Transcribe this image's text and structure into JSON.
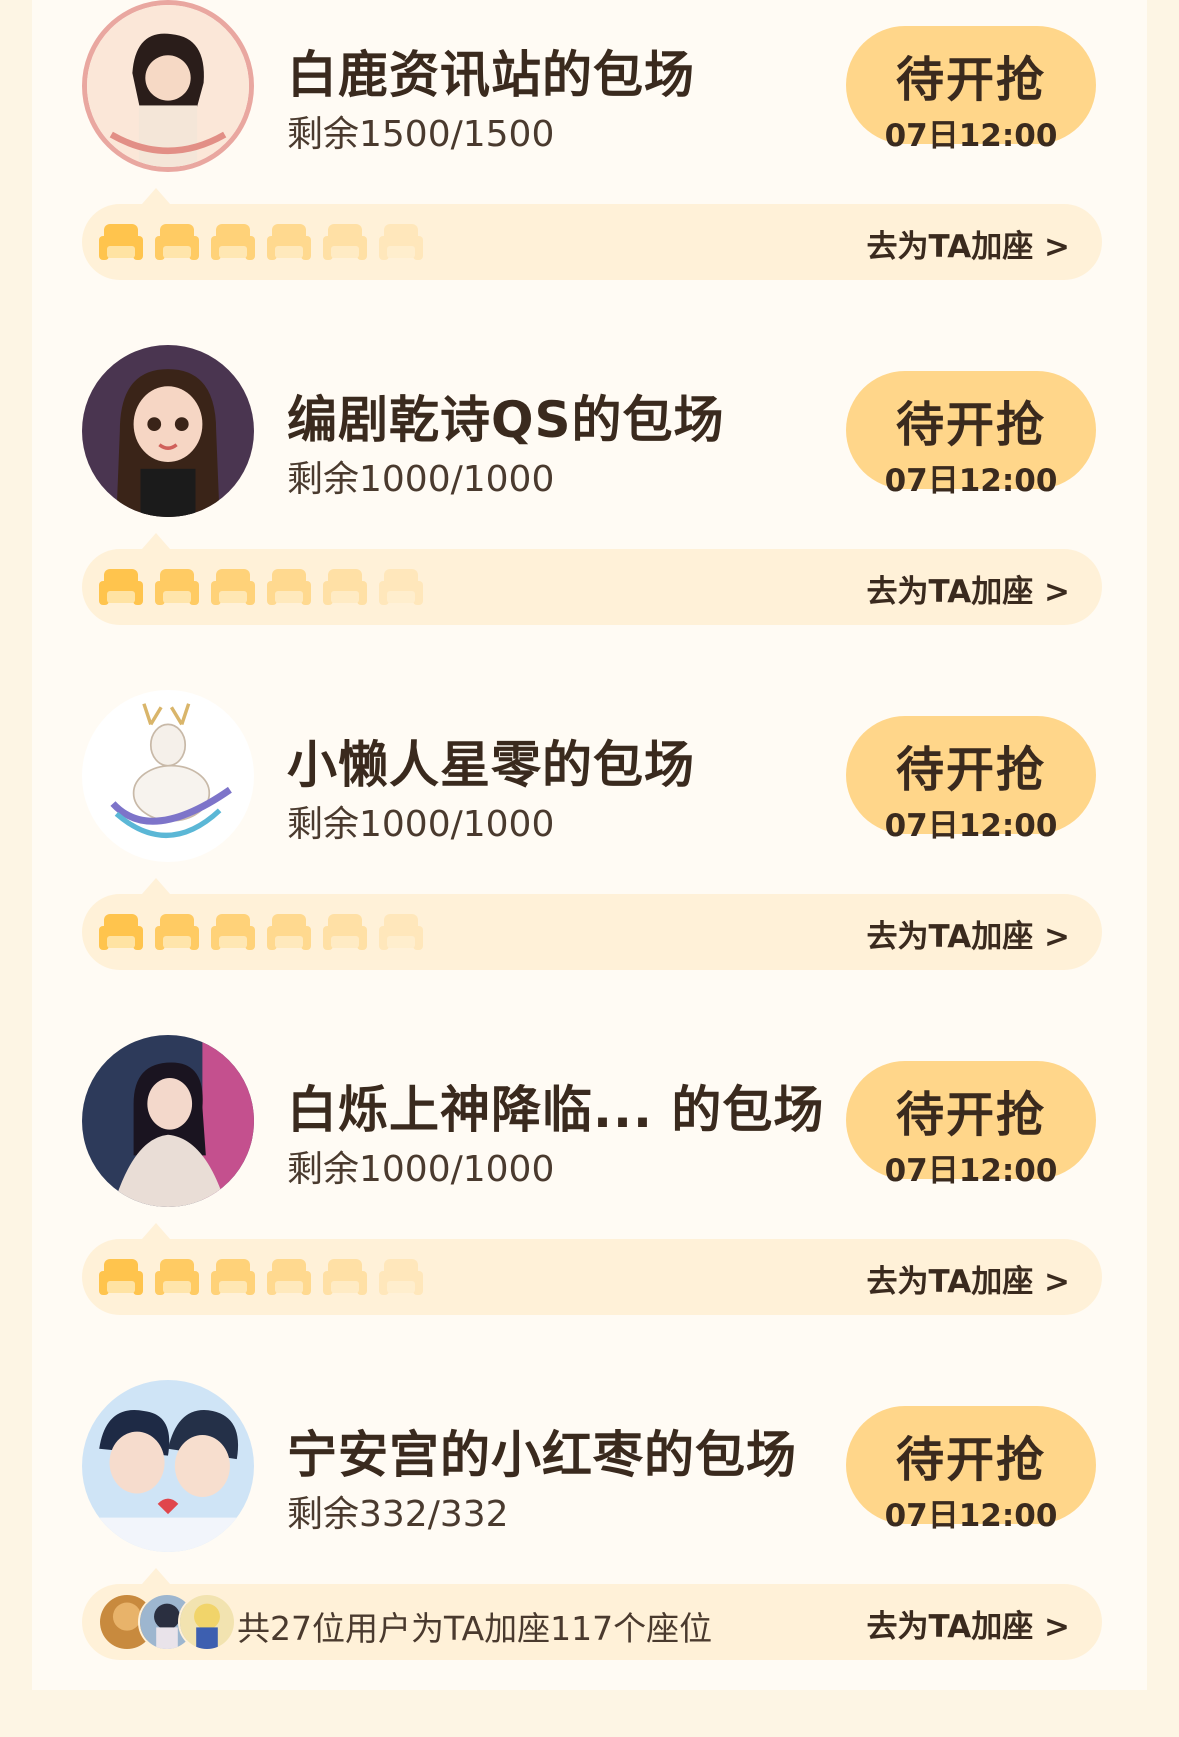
{
  "colors": {
    "page_bg": "#fdf5e4",
    "panel_bg": "#fffbf4",
    "button_bg": "#ffd68a",
    "strip_bg": "#fff1d8",
    "seat_color": "#ffc44d",
    "text_dark": "#3a2a1e"
  },
  "cards": [
    {
      "title": "白鹿资讯站的包场",
      "remaining": "剩余1500/1500",
      "button_label": "待开抢",
      "button_time": "07日12:00",
      "add_label": "去为TA加座 >",
      "avatar_icon": "fan-portrait-avatar"
    },
    {
      "title": "编剧乾诗QS的包场",
      "remaining": "剩余1000/1000",
      "button_label": "待开抢",
      "button_time": "07日12:00",
      "add_label": "去为TA加座 >",
      "avatar_icon": "cartoon-girl-avatar"
    },
    {
      "title": "小懒人星零的包场",
      "remaining": "剩余1000/1000",
      "button_label": "待开抢",
      "button_time": "07日12:00",
      "add_label": "去为TA加座 >",
      "avatar_icon": "white-deer-avatar"
    },
    {
      "title": "白烁上神降临... 的包场",
      "remaining": "剩余1000/1000",
      "button_label": "待开抢",
      "button_time": "07日12:00",
      "add_label": "去为TA加座 >",
      "avatar_icon": "costume-actress-avatar"
    },
    {
      "title": "宁安宫的小红枣的包场",
      "remaining": "剩余332/332",
      "button_label": "待开抢",
      "button_time": "07日12:00",
      "add_label": "去为TA加座 >",
      "avatar_icon": "cartoon-couple-avatar",
      "users_text": "共27位用户为TA加座117个座位"
    }
  ],
  "seat_icon": "sofa-seat-icon",
  "seat_count_per_strip": 6
}
